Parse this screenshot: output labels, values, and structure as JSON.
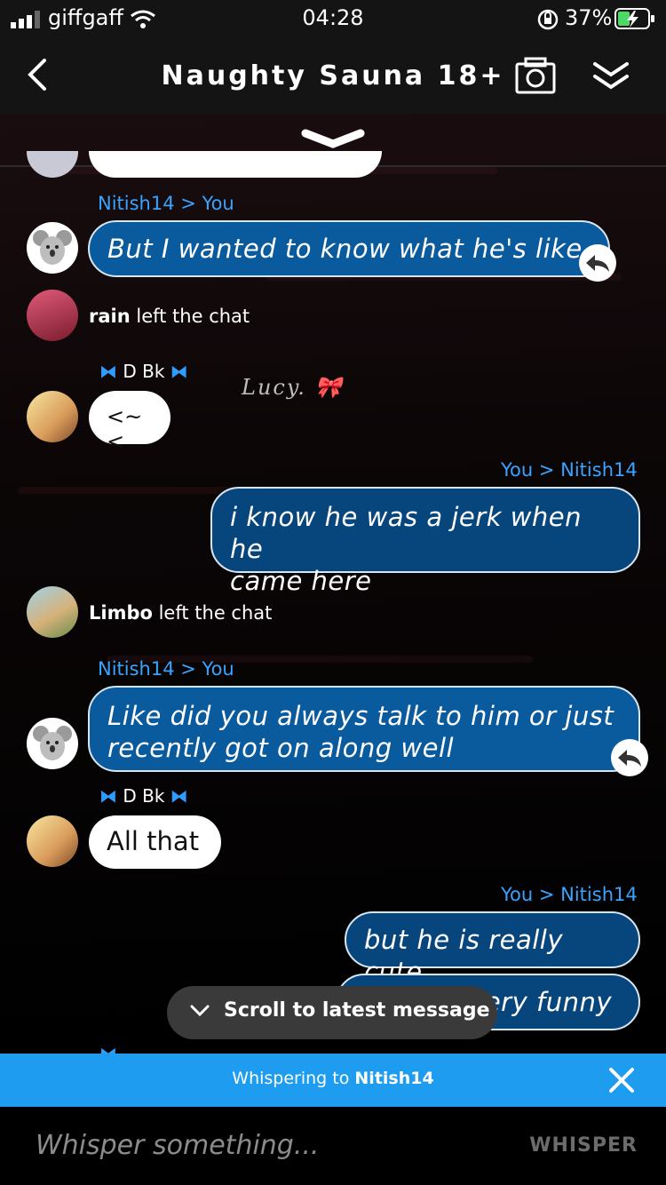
{
  "status_bar": {
    "carrier": "giffgaff",
    "time": "04:28",
    "battery": "37%"
  },
  "header": {
    "title": "Naughty Sauna 18+"
  },
  "messages": {
    "m1_sender": "Nitish14 > You",
    "m1_text": "But I wanted to know what he's like",
    "m2_name": "rain",
    "m2_text": " left the chat",
    "m3_name": "D Bk",
    "m3_watermark": "Lucy.",
    "m3_text": "<~<",
    "m4_sender": "You > Nitish14",
    "m4_line1": "i know he was a jerk when he",
    "m4_line2": "came here",
    "m5_name": "Limbo",
    "m5_text": " left the chat",
    "m6_sender": "Nitish14 > You",
    "m6_line1": "Like did you always talk to him or just",
    "m6_line2": "recently got on along well",
    "m7_name": "D Bk",
    "m7_text": "All that",
    "m8_sender": "You > Nitish14",
    "m8_text": "but he is really cute",
    "m9_text": "ery funny"
  },
  "scroll_pill": {
    "label": "Scroll to latest message"
  },
  "whisper_bar": {
    "prefix": "Whispering to ",
    "target": "Nitish14"
  },
  "input": {
    "placeholder": "Whisper something...",
    "send_label": "WHISPER"
  },
  "colors": {
    "accent": "#1e9cf0",
    "bubble": "#0a5a9e",
    "sender": "#3aa3ff"
  }
}
